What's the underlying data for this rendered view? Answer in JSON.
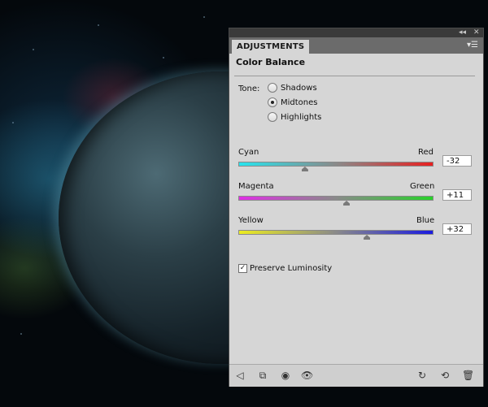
{
  "panel": {
    "tab_label": "ADJUSTMENTS",
    "title_buttons": {
      "collapse": "◂◂",
      "close": "✕"
    },
    "menu_icon": "panel-menu-icon",
    "heading": "Color Balance"
  },
  "tone": {
    "label": "Tone:",
    "options": [
      {
        "label": "Shadows",
        "selected": false
      },
      {
        "label": "Midtones",
        "selected": true
      },
      {
        "label": "Highlights",
        "selected": false
      }
    ]
  },
  "sliders": [
    {
      "left": "Cyan",
      "right": "Red",
      "value": "-32",
      "gradient": [
        "#27e4ee",
        "#e82020"
      ]
    },
    {
      "left": "Magenta",
      "right": "Green",
      "value": "+11",
      "gradient": [
        "#e02ee6",
        "#28d22a"
      ]
    },
    {
      "left": "Yellow",
      "right": "Blue",
      "value": "+32",
      "gradient": [
        "#ecec20",
        "#1c1ce0"
      ]
    }
  ],
  "preserve_luminosity": {
    "label": "Preserve Luminosity",
    "checked": true
  },
  "bottom_icons": [
    "back-arrow-icon",
    "clip-to-layer-icon",
    "visibility-toggle-icon",
    "eye-icon",
    "view-previous-icon",
    "reset-icon",
    "trash-icon"
  ]
}
